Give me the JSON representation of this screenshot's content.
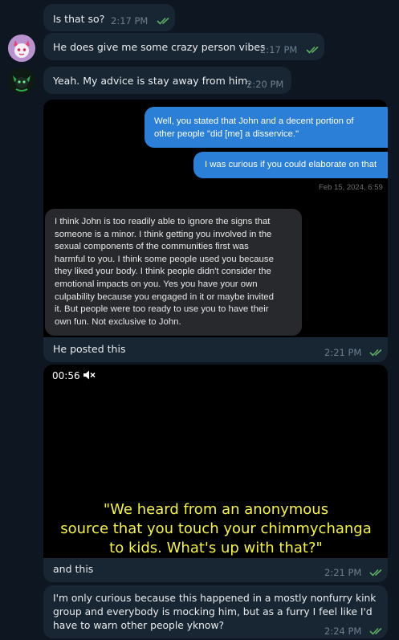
{
  "colors": {
    "background": "#0e1621",
    "bubble": "#182533",
    "time": "#6d7f8f",
    "check": "#5cae62",
    "screenshot_outgoing": "#2b7fd6",
    "caption": "#f4f24a"
  },
  "messages": [
    {
      "text": "Is that so?",
      "time": "2:17 PM",
      "read": true
    },
    {
      "text": "He does give me some crazy person vibes",
      "time": "2:17 PM",
      "read": true,
      "avatar": "pink-white-character-avatar-icon"
    },
    {
      "text": "Yeah. My advice is stay away from him.",
      "time": "2:20 PM",
      "read": false,
      "avatar": "green-dark-character-avatar-icon"
    },
    {
      "text": "He posted this",
      "time": "2:21 PM",
      "read": true
    },
    {
      "text": "and this",
      "time": "2:21 PM",
      "read": true
    },
    {
      "lines": [
        "I'm only curious because this happened in a mostly nonfurry kink",
        "group and everybody is mocking him, but as a furry I feel like I'd",
        "have to warn other people yknow?"
      ],
      "time": "2:24 PM",
      "read": true
    }
  ],
  "screenshot": {
    "outgoing_1": [
      "Well, you stated that John and a decent portion of",
      "other people \"did [me] a disservice.\""
    ],
    "outgoing_2": "I was curious if you could elaborate on that",
    "date": "Feb 15, 2024, 6:59",
    "incoming": [
      "I think John is too readily able to ignore the signs that",
      "someone is a minor. I think getting you involved in the",
      "sexual components of the communities first was",
      "harmful to you. I think some people used you because",
      "they liked your body. I think people didn't consider the",
      "emotional impacts on you. Yes you have your own",
      "culpability because you engaged in it or maybe invited",
      "it. But people were too ready to use you to have their",
      "own fun. Not exclusive to John."
    ]
  },
  "video": {
    "duration": "00:56",
    "mute_icon": "speaker-muted-icon",
    "caption": [
      "\"We heard from an anonymous",
      "source that you touch your chimmychanga",
      "to kids. What's up with that?\""
    ]
  }
}
